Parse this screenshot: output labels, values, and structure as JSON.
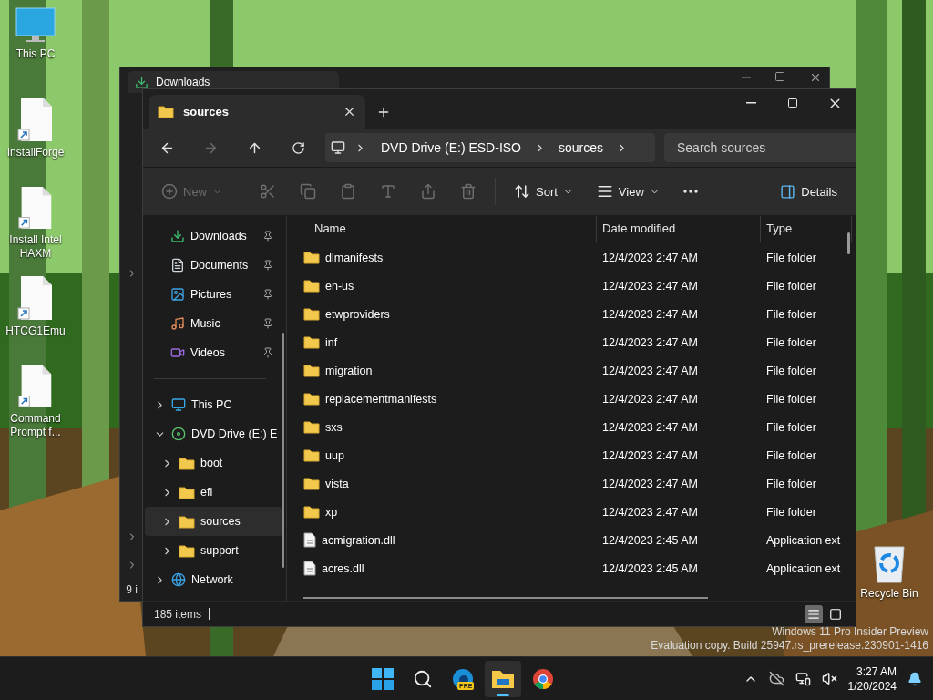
{
  "desktop": {
    "icons": [
      {
        "label": "This PC",
        "kind": "pc"
      },
      {
        "label": "InstallForge",
        "kind": "shortcut"
      },
      {
        "label": "Install Intel HAXM",
        "kind": "shortcut"
      },
      {
        "label": "HTCG1Emu",
        "kind": "shortcut"
      },
      {
        "label": "Command Prompt f...",
        "kind": "shortcut"
      }
    ],
    "recycle_bin": {
      "label": "Recycle Bin"
    },
    "watermark": [
      "Windows 11 Pro Insider Preview",
      "Evaluation copy. Build 25947.rs_prerelease.230901-1416"
    ]
  },
  "back_window": {
    "tab_title": "Downloads",
    "status_text": "9 i"
  },
  "window": {
    "tabs": [
      {
        "title": "sources",
        "selected": true
      }
    ],
    "breadcrumb": [
      "DVD Drive (E:) ESD-ISO",
      "sources"
    ],
    "search": {
      "placeholder": "Search sources"
    },
    "commands": [
      {
        "kind": "new",
        "label": "New",
        "disabled": true
      },
      {
        "kind": "cut",
        "disabled": true
      },
      {
        "kind": "copy",
        "disabled": true
      },
      {
        "kind": "paste",
        "disabled": true
      },
      {
        "kind": "rename",
        "disabled": true
      },
      {
        "kind": "share",
        "disabled": true
      },
      {
        "kind": "delete",
        "disabled": true
      },
      {
        "kind": "sort",
        "label": "Sort",
        "disabled": false
      },
      {
        "kind": "view",
        "label": "View",
        "disabled": false
      },
      {
        "kind": "more",
        "disabled": false
      }
    ],
    "details_button": {
      "label": "Details"
    },
    "quick_access": [
      {
        "label": "Downloads",
        "kind": "download"
      },
      {
        "label": "Documents",
        "kind": "document"
      },
      {
        "label": "Pictures",
        "kind": "pictures"
      },
      {
        "label": "Music",
        "kind": "music"
      },
      {
        "label": "Videos",
        "kind": "videos"
      }
    ],
    "tree": [
      {
        "label": "This PC",
        "kind": "pc",
        "expanded": false,
        "selected": false
      },
      {
        "label": "DVD Drive (E:) E",
        "kind": "dvd",
        "expanded": true,
        "selected": false,
        "children": [
          {
            "label": "boot",
            "kind": "folder",
            "expanded": false,
            "selected": false
          },
          {
            "label": "efi",
            "kind": "folder",
            "expanded": false,
            "selected": false
          },
          {
            "label": "sources",
            "kind": "folder",
            "expanded": false,
            "selected": true
          },
          {
            "label": "support",
            "kind": "folder",
            "expanded": false,
            "selected": false
          }
        ]
      },
      {
        "label": "Network",
        "kind": "network",
        "expanded": false,
        "selected": false
      }
    ],
    "columns": [
      "Name",
      "Date modified",
      "Type"
    ],
    "rows": [
      {
        "name": "dlmanifests",
        "date": "12/4/2023 2:47 AM",
        "type": "File folder",
        "kind": "folder"
      },
      {
        "name": "en-us",
        "date": "12/4/2023 2:47 AM",
        "type": "File folder",
        "kind": "folder"
      },
      {
        "name": "etwproviders",
        "date": "12/4/2023 2:47 AM",
        "type": "File folder",
        "kind": "folder"
      },
      {
        "name": "inf",
        "date": "12/4/2023 2:47 AM",
        "type": "File folder",
        "kind": "folder"
      },
      {
        "name": "migration",
        "date": "12/4/2023 2:47 AM",
        "type": "File folder",
        "kind": "folder"
      },
      {
        "name": "replacementmanifests",
        "date": "12/4/2023 2:47 AM",
        "type": "File folder",
        "kind": "folder"
      },
      {
        "name": "sxs",
        "date": "12/4/2023 2:47 AM",
        "type": "File folder",
        "kind": "folder"
      },
      {
        "name": "uup",
        "date": "12/4/2023 2:47 AM",
        "type": "File folder",
        "kind": "folder"
      },
      {
        "name": "vista",
        "date": "12/4/2023 2:47 AM",
        "type": "File folder",
        "kind": "folder"
      },
      {
        "name": "xp",
        "date": "12/4/2023 2:47 AM",
        "type": "File folder",
        "kind": "folder"
      },
      {
        "name": "acmigration.dll",
        "date": "12/4/2023 2:45 AM",
        "type": "Application ext",
        "kind": "file"
      },
      {
        "name": "acres.dll",
        "date": "12/4/2023 2:45 AM",
        "type": "Application ext",
        "kind": "file"
      }
    ],
    "status": "185 items",
    "view_modes": [
      {
        "kind": "details",
        "selected": true
      },
      {
        "kind": "tiles",
        "selected": false
      }
    ]
  },
  "taskbar": {
    "apps": [
      {
        "kind": "start",
        "active": false
      },
      {
        "kind": "search",
        "active": false
      },
      {
        "kind": "edge",
        "badge": "PRE",
        "active": false
      },
      {
        "kind": "explorer",
        "active": true
      },
      {
        "kind": "chrome",
        "active": false
      }
    ],
    "time": "3:27 AM",
    "date": "1/20/2024"
  }
}
